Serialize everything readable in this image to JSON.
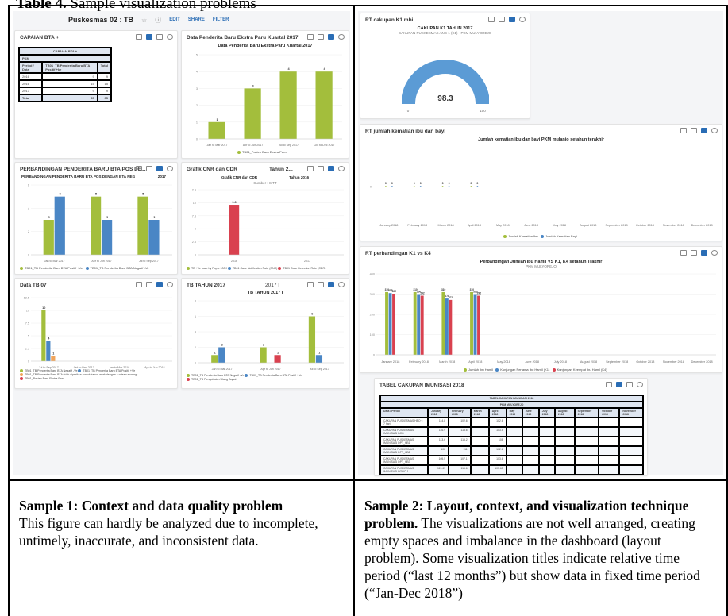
{
  "caption": {
    "label": "Table 4.",
    "text": "Sample visualization problems"
  },
  "sample1": {
    "dashboard": {
      "title": "Puskesmas 02 : TB",
      "actions": [
        "EDIT",
        "SHARE",
        "FILTER"
      ],
      "panels": {
        "capaian": {
          "title": "CAPAIAN BTA +",
          "table_title": "CAPAIAN BTA +",
          "table_sub": "PKM",
          "headers": [
            "Period / Data",
            "TB01_TB Penderita Baru BTA Positif +ke",
            "Total"
          ],
          "rows": [
            [
              "2016",
              "9",
              "9"
            ],
            [
              "2016",
              "15",
              "15"
            ],
            [
              "2017",
              "9",
              "9"
            ],
            [
              "Total",
              "35",
              "35"
            ]
          ]
        },
        "ekstra": {
          "title": "Data Penderita Baru Ekstra Paru Kuartal 2017",
          "chart_title": "Data Penderita Baru Ekstra Paru Kuartal 2017",
          "legend": "TB01_Pasien Baru Ekstra Paru"
        },
        "perbandingan": {
          "title": "PERBANDINGAN PENDERITA BARU BTA POS DE...",
          "chart_title": "PERBANDINGAN PENDERITA BARU BTA POS DENGAN BTA NEG",
          "chart_year": "2017",
          "legend": [
            "TB01_TB Penderita Baru BTA Positif +Ve",
            "TB01_TB Penderita Baru BTA Negatif -Ve"
          ]
        },
        "cnr": {
          "title": "Grafik CNR dan CDR",
          "title2": "Tahun 2...",
          "chart_title": "Grafik CNR dan CDR",
          "chart_title2": "Tahun 2016",
          "chart_sub": "Sumber : SITT",
          "legend": [
            "TB +Ve case by Pop x 100K",
            "TB01 Case Notification Rate (CNR)",
            "TB01 Case Detection Rate (CDR)"
          ]
        },
        "datatb": {
          "title": "Data TB 07",
          "legend": [
            "TB01_TB Penderita Baru BTA Negatif -Ve",
            "TB01_TB Penderita Baru BTA Positif +Ve",
            "TB01_TB Penderita Baru BTA tidak diperiksa (untuk kasus anak dengan x rotsen skoring)",
            "TB01_Pasien Baru Ekstra Paru"
          ]
        },
        "tbtahun": {
          "title": "TB TAHUN 2017",
          "title2": "2017 I",
          "chart_title": "TB TAHUN 2017 I",
          "legend": [
            "TB01_TB Penderita Baru BTA Negatif -Ve",
            "TB01_TB Penderita Baru BTA Positif +Ve",
            "TB01_TB Pengobatan Ulang Dapat"
          ]
        }
      }
    },
    "heading": "Sample 1: Context and data quality problem",
    "body": "This figure can hardly be analyzed due to incomplete, untimely, inaccurate, and inconsistent data."
  },
  "sample2": {
    "panels": {
      "k1": {
        "title": "RT cakupan K1 mbi",
        "chart_title": "CAKUPAN K1 TAHUN 2017",
        "chart_sub": "CAKUPAN PUSKESMAS ANC 1 (K1) - PKM MULYOREJO",
        "gauge_value": "98.3",
        "gauge_min": "0",
        "gauge_max": "100"
      },
      "kematian": {
        "title": "RT jumlah kematian ibu dan bayi",
        "chart_title": "Jumlah kematian ibu dan bayi PKM mulanjo setahun terakhir",
        "legend": [
          "Jumlah Kematian Ibu",
          "Jumlah Kematian Bayi"
        ]
      },
      "k1k4": {
        "title": "RT perbandingan K1 vs K4",
        "chart_title": "Perbandingan Jumlah Ibu Hamil VS K1, K4 setahun Trakhir",
        "chart_sub": "PKM MULYOREJO",
        "legend": [
          "Jumlah Ibu Hamil",
          "Kunjungan Pertama Ibu Hamil (K1)",
          "Kunjungan Keempat Ibu Hamil (K4)"
        ]
      },
      "imunisasi": {
        "title": "TABEL CAKUPAN IMUNISASI 2018",
        "table_title": "TABEL CAKUPAN IMUNISASI 2018",
        "table_sub": "PKM MULYOREJO",
        "headers": [
          "Data / Period",
          "January 2018",
          "February 2018",
          "March 2018",
          "April 2018",
          "May 2018",
          "June 2018",
          "July 2018",
          "August 2018",
          "September 2018",
          "October 2018",
          "November 2018"
        ],
        "rows": [
          [
            "CAKUPAN PUSKESMAS HBO < 7 hari",
            "114.8",
            "102.6",
            "",
            "102.6"
          ],
          [
            "CAKUPAN PUSKESMAS IMUNISASI BCG",
            "116.9",
            "113.6",
            "",
            "103.5"
          ],
          [
            "CAKUPAN PUSKESMAS IMUNISASI DPT_HB1",
            "113.6",
            "115.2",
            "",
            "108"
          ],
          [
            "CAKUPAN PUSKESMAS IMUNISASI DPT_HB2",
            "108",
            "111",
            "",
            "102.6"
          ],
          [
            "CAKUPAN PUSKESMAS IMUNISASI DPT_HB3",
            "105.5",
            "107.1",
            "",
            "103.6"
          ],
          [
            "CAKUPAN PUSKESMAS IMUNISASI POLIO 1",
            "119.69",
            "115.6",
            "",
            "103.65"
          ],
          [
            "CAKUPAN PUSKESMAS IMUNISASI POLIO 2",
            "113.93",
            "115.24",
            "",
            "106.15"
          ],
          [
            "CAKUPAN PUSKESMAS IMUNISASI POLIO 3",
            "106.22",
            "111.32",
            "",
            "108.47"
          ]
        ]
      }
    },
    "months": [
      "January 2018",
      "February 2018",
      "March 2018",
      "April 2018",
      "May 2018",
      "June 2018",
      "July 2018",
      "August 2018",
      "September 2018",
      "October 2018",
      "November 2018",
      "December 2018"
    ],
    "heading": "Sample 2: Layout, context, and visualization technique problem.",
    "body": "The visualizations are not well arranged, creating empty spaces and imbalance in the dashboard (layout problem). Some visualization titles indicate relative time period (“last 12 months”) but show data in fixed time period (“Jan-Dec 2018”)"
  },
  "colors": {
    "green": "#a3be3c",
    "blue": "#4a86c5",
    "red": "#d9414f",
    "orange": "#f0a45a",
    "gauge": "#5b9bd5",
    "accent": "#2a6db5"
  },
  "chart_data": [
    {
      "type": "bar",
      "categories": [
        "Jan to Mar 2017",
        "Apr to Jun 2017",
        "Jul to Sep 2017",
        "Oct to Dec 2017"
      ],
      "series": [
        {
          "name": "TB01_Pasien Baru Ekstra Paru",
          "values": [
            1,
            3,
            4,
            4
          ]
        }
      ],
      "title": "Data Penderita Baru Ekstra Paru Kuartal 2017",
      "ylim": [
        0,
        5
      ]
    },
    {
      "type": "bar",
      "categories": [
        "Jan to Mar 2017",
        "Apr to Jun 2017",
        "Jul to Sep 2017"
      ],
      "series": [
        {
          "name": "TB01_TB Penderita Baru BTA Positif +Ve",
          "values": [
            3,
            5,
            5
          ]
        },
        {
          "name": "TB01_TB Penderita Baru BTA Negatif -Ve",
          "values": [
            5,
            3,
            3
          ]
        }
      ],
      "title": "PERBANDINGAN PENDERITA BARU BTA POS DENGAN BTA NEG",
      "ylim": [
        0,
        6
      ]
    },
    {
      "type": "bar",
      "categories": [
        "2016",
        "2017"
      ],
      "series": [
        {
          "name": "TB01 Case Notification Rate (CNR)",
          "values": [
            9.6,
            0
          ]
        }
      ],
      "title": "Grafik CNR dan CDR",
      "ylim": [
        0,
        12.5
      ]
    },
    {
      "type": "bar",
      "categories": [
        "Jul to Sep 2017",
        "Oct to Dec 2017",
        "Jan to Mar 2018",
        "Apr to Jun 2018"
      ],
      "series": [
        {
          "name": "TB01_TB Penderita Baru BTA Negatif -Ve",
          "values": [
            10,
            0,
            0,
            0
          ]
        },
        {
          "name": "TB01_TB Penderita Baru BTA Positif +Ve",
          "values": [
            4,
            0,
            0,
            0
          ]
        },
        {
          "name": "TB01_TB Penderita Baru BTA tidak diperiksa (untuk kasus anak dengan x rotsen skoring)",
          "values": [
            1,
            0,
            0,
            0
          ]
        }
      ],
      "ylim": [
        0,
        12.5
      ]
    },
    {
      "type": "bar",
      "categories": [
        "Jan to Mar 2017",
        "Apr to Jun 2017",
        "Jul to Sep 2017"
      ],
      "series": [
        {
          "name": "TB01_TB Penderita Baru BTA Negatif -Ve",
          "values": [
            1,
            2,
            6
          ]
        },
        {
          "name": "TB01_TB Penderita Baru BTA Positif +Ve",
          "values": [
            2,
            0,
            1
          ]
        },
        {
          "name": "TB01_TB Pengobatan Ulang Dapat",
          "values": [
            0,
            1,
            0
          ]
        }
      ],
      "title": "TB TAHUN 2017 I",
      "ylim": [
        0,
        8
      ]
    },
    {
      "type": "line",
      "categories": [
        "January 2018",
        "February 2018",
        "March 2018",
        "April 2018"
      ],
      "series": [
        {
          "name": "Jumlah Kematian Ibu",
          "values": [
            0,
            0,
            0,
            0
          ]
        },
        {
          "name": "Jumlah Kematian Bayi",
          "values": [
            0,
            0,
            0,
            0
          ]
        }
      ],
      "title": "Jumlah kematian ibu dan bayi PKM mulanjo setahun terakhir"
    },
    {
      "type": "bar",
      "categories": [
        "January 2018",
        "February 2018",
        "March 2018",
        "April 2018"
      ],
      "series": [
        {
          "name": "Jumlah Ibu Hamil",
          "values": [
            310,
            310,
            310,
            310
          ]
        },
        {
          "name": "Kunjungan Pertama Ibu Hamil (K1)",
          "values": [
            305,
            300,
            278,
            300
          ]
        },
        {
          "name": "Kunjungan Keempat Ibu Hamil (K4)",
          "values": [
            302,
            292,
            271,
            292
          ]
        }
      ],
      "title": "Perbandingan Jumlah Ibu Hamil VS K1, K4 setahun Trakhir",
      "ylim": [
        0,
        400
      ]
    }
  ]
}
